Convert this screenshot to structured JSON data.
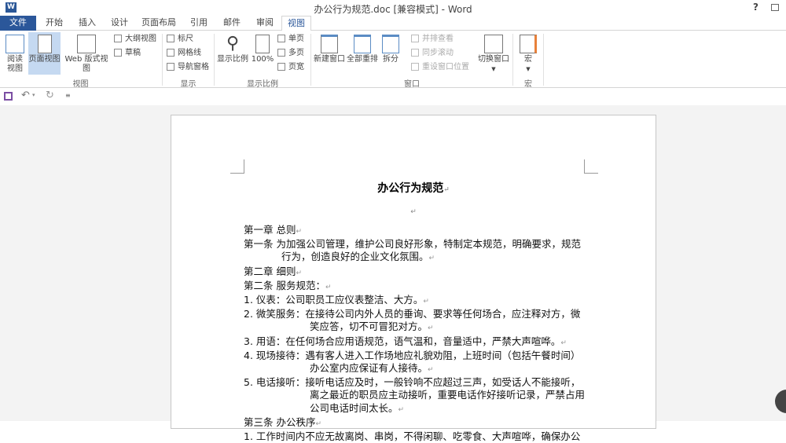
{
  "window": {
    "title": "办公行为规范.doc [兼容模式] - Word",
    "app_icon": "W",
    "help": "?"
  },
  "tabs": [
    "文件",
    "开始",
    "插入",
    "设计",
    "页面布局",
    "引用",
    "邮件",
    "审阅",
    "视图"
  ],
  "ribbon": {
    "views": {
      "label": "视图",
      "read": "阅读视图",
      "print": "页面视图",
      "web": "Web 版式视图",
      "outline": "大纲视图",
      "draft": "草稿"
    },
    "show": {
      "label": "显示",
      "ruler": "标尺",
      "gridlines": "网格线",
      "nav": "导航窗格"
    },
    "zoom": {
      "label": "显示比例",
      "zoom": "显示比例",
      "hundred": "100%",
      "one": "单页",
      "multi": "多页",
      "width": "页宽"
    },
    "window": {
      "label": "窗口",
      "new": "新建窗口",
      "arrange": "全部重排",
      "split": "拆分",
      "side": "并排查看",
      "sync": "同步滚动",
      "reset": "重设窗口位置",
      "switch": "切换窗口"
    },
    "macros": {
      "label": "宏",
      "macros": "宏"
    }
  },
  "document": {
    "title": "办公行为规范",
    "lines": [
      {
        "t": "第一章  总则",
        "i": 0
      },
      {
        "t": "第一条  为加强公司管理，维护公司良好形象，特制定本规范，明确要求，规范",
        "i": 0,
        "nomark": true
      },
      {
        "t": "行为，创造良好的企业文化氛围。",
        "i": 1
      },
      {
        "t": "第二章  细则",
        "i": 0
      },
      {
        "t": "第二条  服务规范：",
        "i": 0
      },
      {
        "t": "1. 仪表：公司职员工应仪表整洁、大方。",
        "i": 0
      },
      {
        "t": "2. 微笑服务：在接待公司内外人员的垂询、要求等任何场合，应注释对方，微",
        "i": 0,
        "nomark": true
      },
      {
        "t": "笑应答，切不可冒犯对方。",
        "i": 2
      },
      {
        "t": "3. 用语：在任何场合应用语规范，语气温和，音量适中，严禁大声喧哗。",
        "i": 0
      },
      {
        "t": "4. 现场接待：遇有客人进入工作场地应礼貌劝阻，上班时间（包括午餐时间）",
        "i": 0,
        "nomark": true
      },
      {
        "t": "办公室内应保证有人接待。",
        "i": 2
      },
      {
        "t": "5. 电话接听：接听电话应及时，一般铃响不应超过三声，如受话人不能接听，",
        "i": 0,
        "nomark": true
      },
      {
        "t": "离之最近的职员应主动接听，重要电话作好接听记录，严禁占用",
        "i": 2,
        "nomark": true
      },
      {
        "t": "公司电话时间太长。",
        "i": 2
      },
      {
        "t": "第三条  办公秩序",
        "i": 0
      },
      {
        "t": "1. 工作时间内不应无故离岗、串岗，不得闲聊、吃零食、大声喧哗，确保办公",
        "i": 0,
        "nomark": true
      }
    ],
    "para_mark": "↵"
  }
}
